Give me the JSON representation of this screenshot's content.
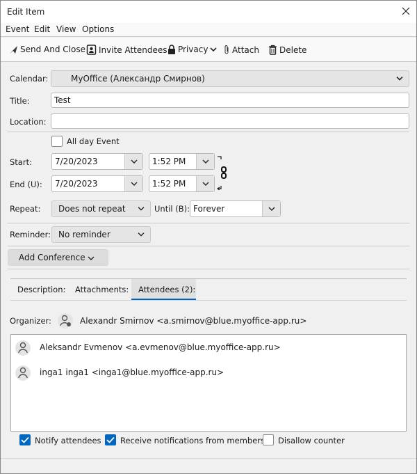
{
  "window": {
    "title": "Edit Item",
    "close_icon": "close-icon"
  },
  "menu": [
    "Event",
    "Edit",
    "View",
    "Options"
  ],
  "toolbar": {
    "send": "Send And Close",
    "invite": "Invite Attendees",
    "privacy": "Privacy",
    "attach": "Attach",
    "delete": "Delete"
  },
  "form": {
    "calendar_label": "Calendar:",
    "calendar_value": "MyOffice (Александр Смирнов)",
    "title_label": "Title:",
    "title_value": "Test",
    "location_label": "Location:",
    "location_value": "",
    "allday_label": "All day Event",
    "allday_checked": false,
    "start_label": "Start:",
    "start_date": "7/20/2023",
    "start_time": "1:52 PM",
    "end_label": "End (U):",
    "end_date": "7/20/2023",
    "end_time": "1:52 PM",
    "repeat_label": "Repeat:",
    "repeat_value": "Does not repeat",
    "until_label": "Until (B):",
    "until_value": "Forever",
    "reminder_label": "Reminder:",
    "reminder_value": "No reminder",
    "conference_label": "Add Conference"
  },
  "tabs": [
    {
      "label": "Description:"
    },
    {
      "label": "Attachments:"
    },
    {
      "label": "Attendees (2):",
      "active": true
    }
  ],
  "attendees": {
    "organizer_label": "Organizer:",
    "organizer": "Alexandr Smirnov <a.smirnov@blue.myoffice-app.ru>",
    "list": [
      "Aleksandr Evmenov <a.evmenov@blue.myoffice-app.ru>",
      "inga1 inga1 <inga1@blue.myoffice-app.ru>"
    ],
    "notify": "Notify attendees",
    "notify_checked": true,
    "receive": "Receive notifications from members",
    "receive_checked": true,
    "disallow": "Disallow counter",
    "disallow_checked": false
  },
  "colors": {
    "accent": "#0067c0"
  }
}
